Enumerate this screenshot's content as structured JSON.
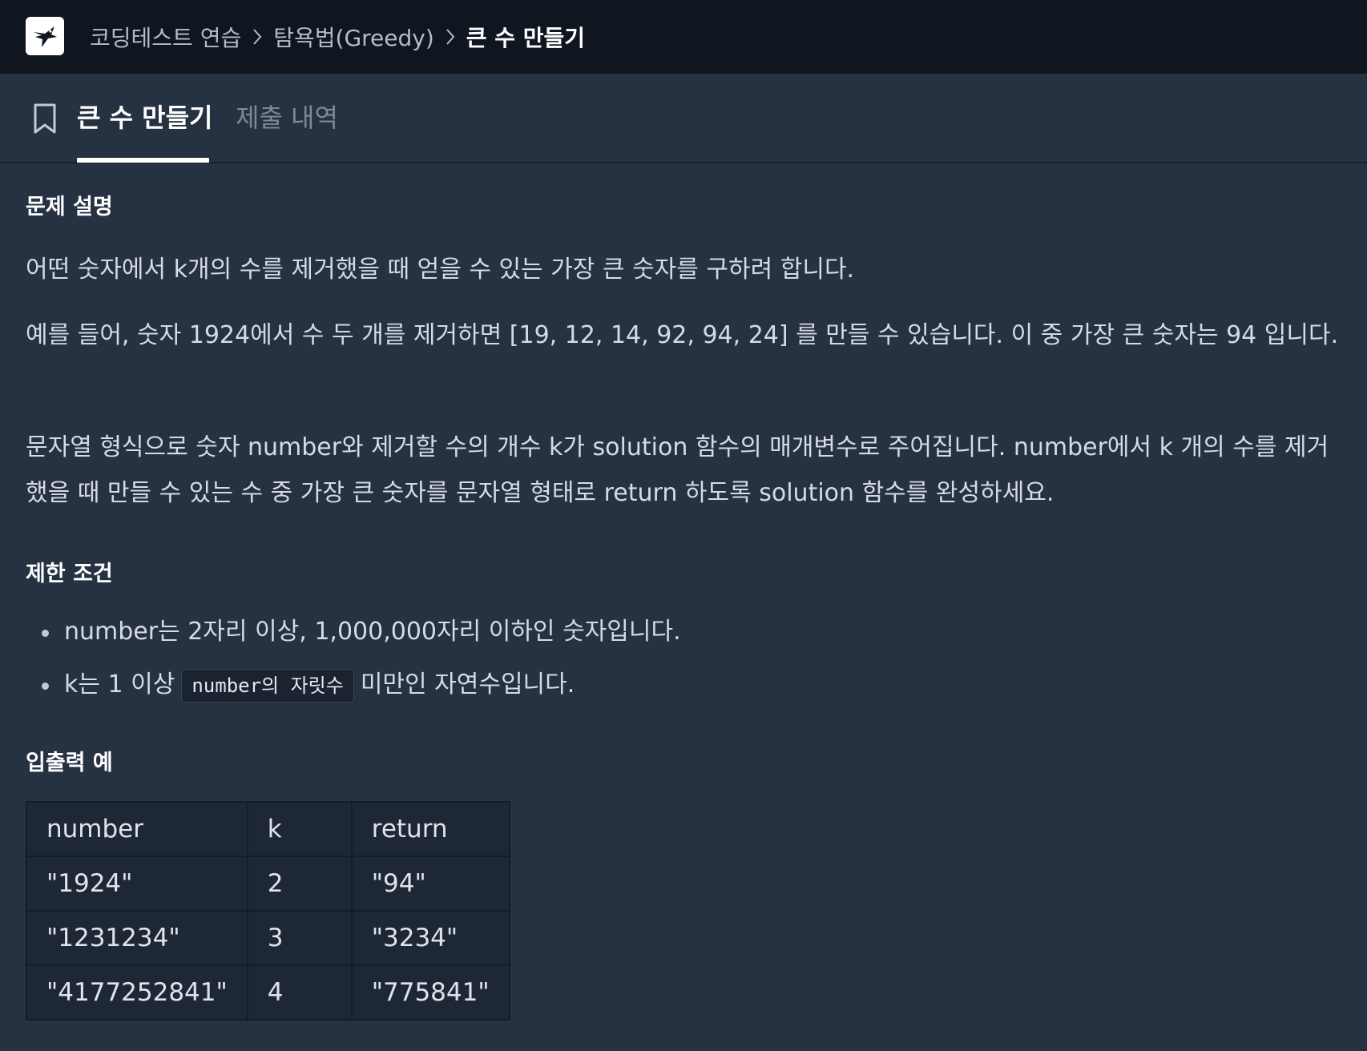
{
  "breadcrumb": {
    "items": [
      "코딩테스트 연습",
      "탐욕법(Greedy)"
    ],
    "current": "큰 수 만들기"
  },
  "tabs": {
    "active": "큰 수 만들기",
    "inactive": "제출 내역"
  },
  "problem": {
    "heading": "문제 설명",
    "paragraphs": [
      "어떤 숫자에서 k개의 수를 제거했을 때 얻을 수 있는 가장 큰 숫자를 구하려 합니다.",
      "예를 들어, 숫자 1924에서 수 두 개를 제거하면 [19, 12, 14, 92, 94, 24] 를 만들 수 있습니다. 이 중 가장 큰 숫자는 94 입니다.",
      "문자열 형식으로 숫자 number와 제거할 수의 개수 k가 solution 함수의 매개변수로 주어집니다. number에서 k 개의 수를 제거했을 때 만들 수 있는 수 중 가장 큰 숫자를 문자열 형태로 return 하도록 solution 함수를 완성하세요."
    ]
  },
  "constraints": {
    "heading": "제한 조건",
    "item1": "number는 2자리 이상, 1,000,000자리 이하인 숫자입니다.",
    "item2_before": "k는 1 이상",
    "item2_code": "number의 자릿수",
    "item2_after": "미만인 자연수입니다."
  },
  "examples": {
    "heading": "입출력 예",
    "columns": [
      "number",
      "k",
      "return"
    ],
    "rows": [
      [
        "\"1924\"",
        "2",
        "\"94\""
      ],
      [
        "\"1231234\"",
        "3",
        "\"3234\""
      ],
      [
        "\"4177252841\"",
        "4",
        "\"775841\""
      ]
    ]
  }
}
